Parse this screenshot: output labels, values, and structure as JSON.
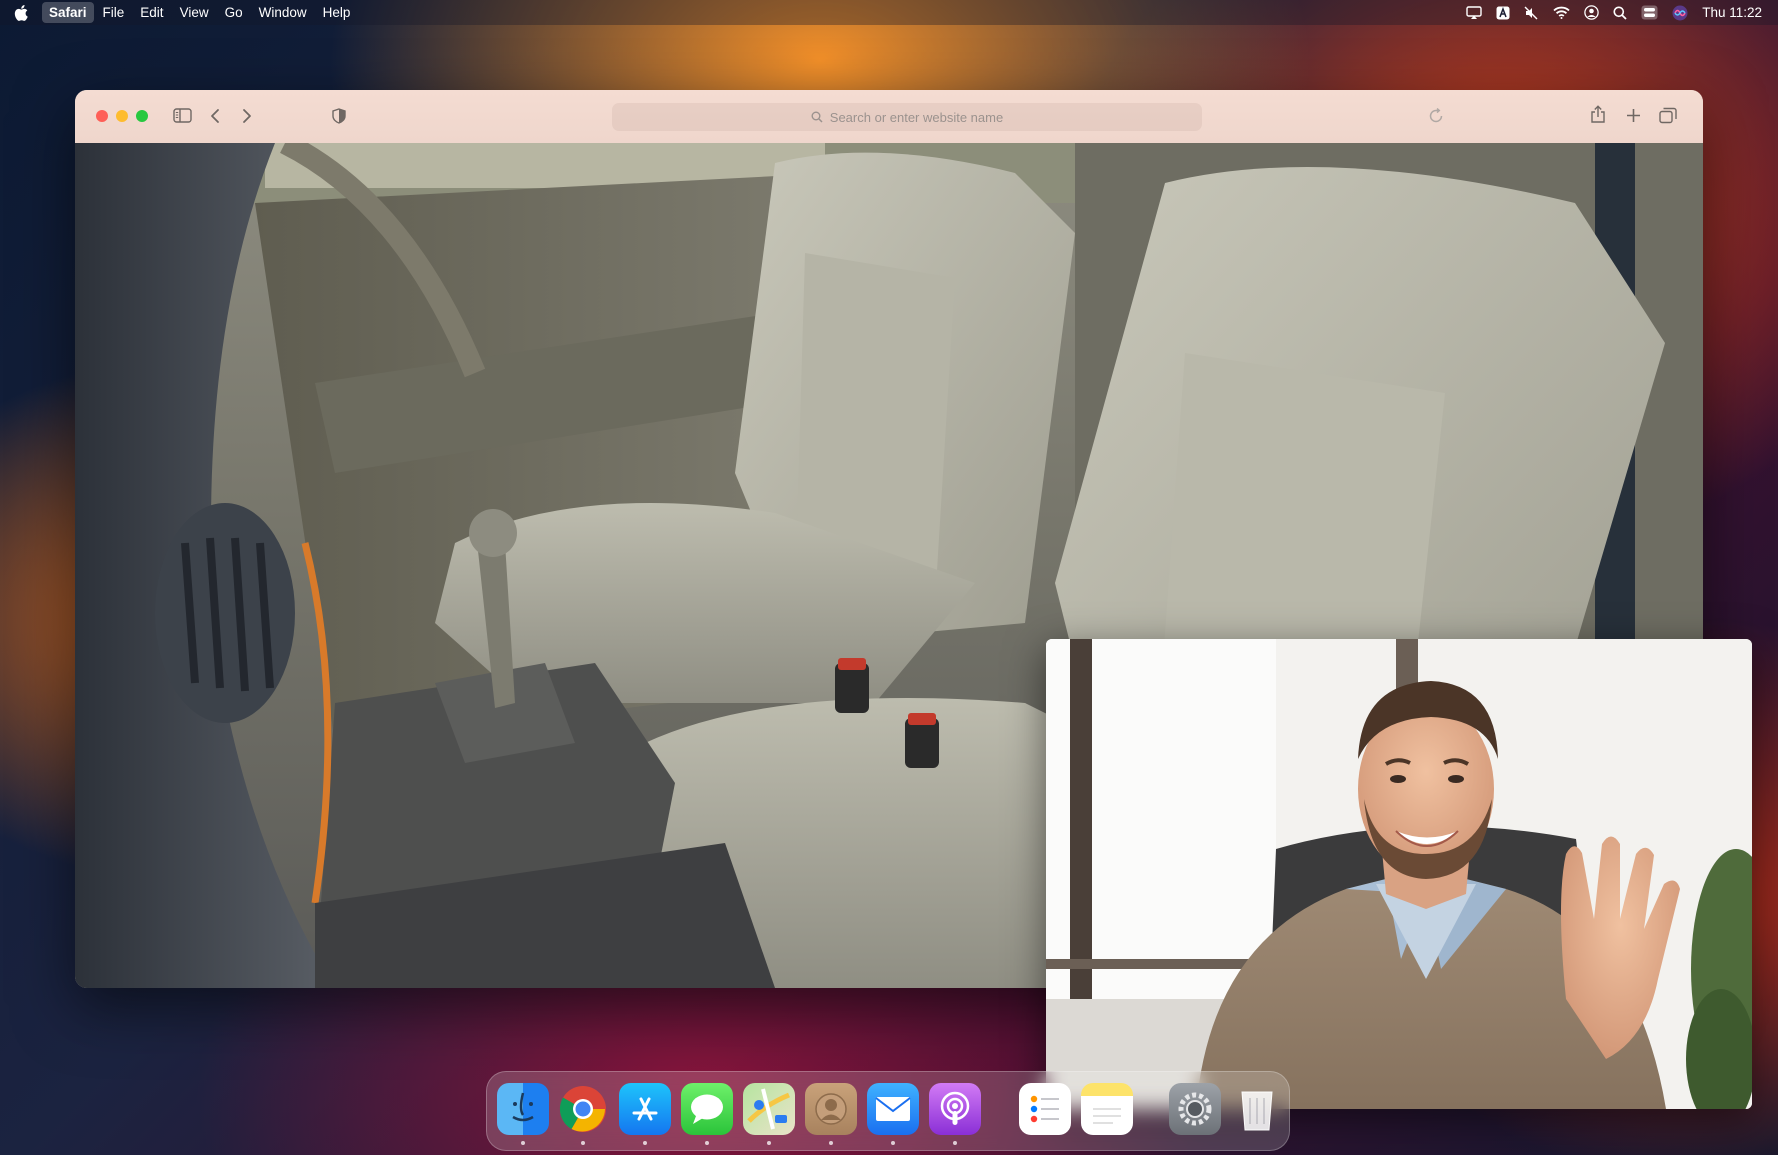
{
  "menubar": {
    "app_name": "Safari",
    "items": [
      "File",
      "Edit",
      "View",
      "Go",
      "Window",
      "Help"
    ],
    "status_icons": [
      "airplay-icon",
      "keyboard-input-icon",
      "mute-icon",
      "wifi-icon",
      "user-icon",
      "spotlight-search-icon",
      "control-center-icon",
      "siri-icon"
    ],
    "clock": "Thu 11:22"
  },
  "browser": {
    "address_placeholder": "Search or enter website name",
    "toolbar_icons": [
      "sidebar-icon",
      "back-icon",
      "forward-icon",
      "privacy-shield-icon",
      "reload-icon",
      "share-icon",
      "new-tab-icon",
      "tab-overview-icon"
    ]
  },
  "dock": {
    "apps": [
      "Finder",
      "Chrome",
      "App Store",
      "Messages",
      "Maps",
      "Contacts",
      "Mail",
      "Podcasts",
      "Reminders",
      "Notes",
      "System Settings",
      "Trash"
    ]
  },
  "colors": {
    "close": "#fe5f57",
    "minimize": "#febc2e",
    "maximize": "#28c840",
    "toolbar_bg": "#f4dcd2"
  }
}
